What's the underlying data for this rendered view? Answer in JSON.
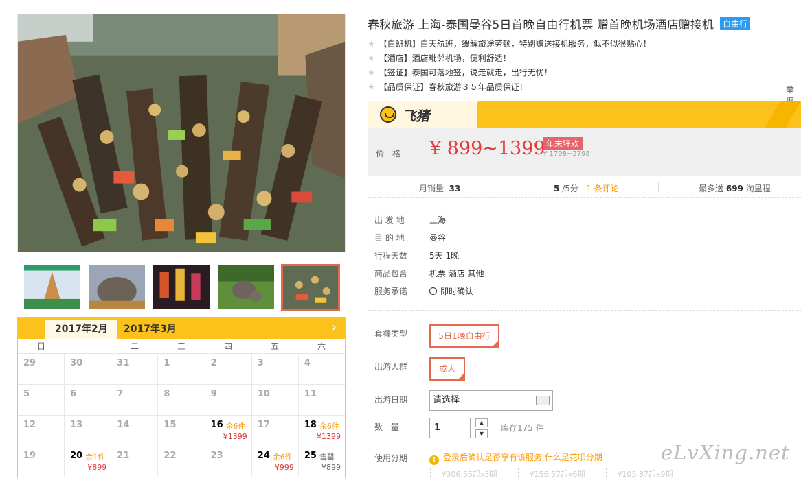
{
  "product": {
    "title": "春秋旅游 上海-泰国曼谷5日首晚自由行机票 赠首晚机场酒店赠接机",
    "badge": "自由行",
    "features": [
      "【白班机】白天航班，缓解旅途劳顿，特别赠送接机服务，似不似很贴心！",
      "【酒店】酒店毗邻机场，便利舒适！",
      "【签证】泰国可落地签，说走就走，出行无忧！",
      "【品质保证】春秋旅游３５年品质保证！"
    ],
    "report_label": "举报"
  },
  "brand": {
    "name": "飞猪",
    "accent": "#fcc21b"
  },
  "price": {
    "label": "价格",
    "value": "¥ 899~1399",
    "promo_tag": "年末狂欢",
    "original": "¥ 1798~2798"
  },
  "stats": {
    "monthly_sales_label": "月销量",
    "monthly_sales": "33",
    "rating": "5",
    "rating_suffix": "/5分",
    "reviews": "1 条评论",
    "points_label": "最多送",
    "points": "699",
    "points_suffix": "淘里程"
  },
  "info": [
    {
      "label": "出 发 地",
      "value": "上海"
    },
    {
      "label": "目 的 地",
      "value": "曼谷"
    },
    {
      "label": "行程天数",
      "value": "5天 1晚"
    },
    {
      "label": "商品包含",
      "value": "机票  酒店  其他"
    },
    {
      "label": "服务承诺",
      "value": "即时确认"
    }
  ],
  "options": {
    "package_label": "套餐类型",
    "package_value": "5日1晚自由行",
    "group_label": "出游人群",
    "group_value": "成人",
    "date_label": "出游日期",
    "date_value": "请选择",
    "qty_label": "数　量",
    "qty_value": "1",
    "stock": "库存175 件",
    "installment_label": "使用分期",
    "installment_text": "登录后确认是否享有该服务",
    "installment_link": "什么是花呗分期",
    "installment_plans": [
      "¥306.55起x3期",
      "¥156.57起x6期",
      "¥105.87起x9期"
    ]
  },
  "calendar": {
    "tabs": [
      "2017年2月",
      "2017年3月"
    ],
    "next_icon": "›",
    "weekdays": [
      "日",
      "一",
      "二",
      "三",
      "四",
      "五",
      "六"
    ],
    "rows": [
      [
        {
          "d": "29"
        },
        {
          "d": "30"
        },
        {
          "d": "31"
        },
        {
          "d": "1"
        },
        {
          "d": "2"
        },
        {
          "d": "3"
        },
        {
          "d": "4"
        }
      ],
      [
        {
          "d": "5"
        },
        {
          "d": "6"
        },
        {
          "d": "7"
        },
        {
          "d": "8"
        },
        {
          "d": "9"
        },
        {
          "d": "10"
        },
        {
          "d": "11"
        }
      ],
      [
        {
          "d": "12"
        },
        {
          "d": "13"
        },
        {
          "d": "14"
        },
        {
          "d": "15"
        },
        {
          "d": "16",
          "s": "余6件",
          "p": "¥1399"
        },
        {
          "d": "17"
        },
        {
          "d": "18",
          "s": "余6件",
          "p": "¥1399"
        }
      ],
      [
        {
          "d": "19"
        },
        {
          "d": "20",
          "s": "余1件",
          "p": "¥899"
        },
        {
          "d": "21"
        },
        {
          "d": "22"
        },
        {
          "d": "23"
        },
        {
          "d": "24",
          "s": "余6件",
          "p": "¥999"
        },
        {
          "d": "25",
          "s": "售罄",
          "p": "¥899",
          "sold": true
        }
      ]
    ]
  },
  "watermark": "eLvXing.net"
}
